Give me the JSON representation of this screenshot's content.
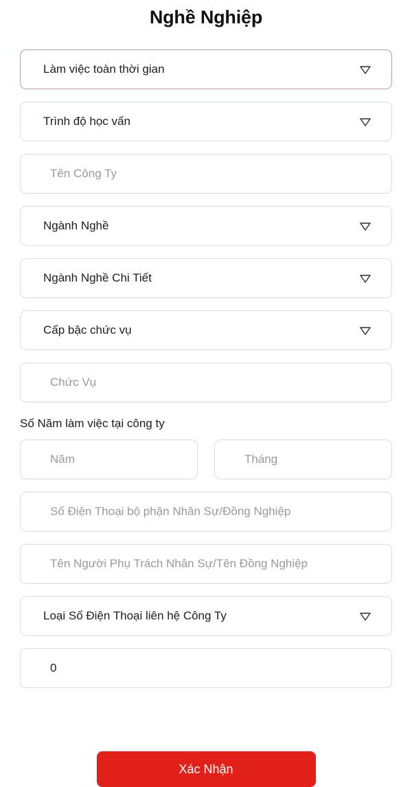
{
  "header": {
    "title": "Nghề Nghiệp"
  },
  "colors": {
    "accent_red": "#e2201a",
    "focused_border": "#c79a9a",
    "default_border": "#dcdcdc",
    "placeholder_text": "#9a9a9a",
    "value_text": "#1d1d1d"
  },
  "icons": {
    "dropdown_caret": "▽"
  },
  "form": {
    "fields": [
      {
        "name": "employment-type",
        "kind": "select",
        "value": "Làm việc toàn thời gian",
        "focused": true,
        "has_caret": true
      },
      {
        "name": "education-level",
        "kind": "select",
        "value": "Trình độ học vấn",
        "focused": false,
        "has_caret": true
      },
      {
        "name": "company-name",
        "kind": "input",
        "placeholder": "Tên Công Ty",
        "value": "",
        "focused": false,
        "has_caret": false
      },
      {
        "name": "industry",
        "kind": "select",
        "value": "Ngành Nghề",
        "focused": false,
        "has_caret": true
      },
      {
        "name": "industry-detail",
        "kind": "select",
        "value": "Ngành Nghề Chi Tiết",
        "focused": false,
        "has_caret": true
      },
      {
        "name": "position-level",
        "kind": "select",
        "value": "Cấp bậc chức vụ",
        "focused": false,
        "has_caret": true
      },
      {
        "name": "job-title",
        "kind": "input",
        "placeholder": "Chức Vụ",
        "value": "",
        "focused": false,
        "has_caret": false
      }
    ],
    "tenure": {
      "label": "Số Năm làm việc tại công ty",
      "years": {
        "name": "tenure-years",
        "kind": "input",
        "placeholder": "Năm",
        "value": ""
      },
      "months": {
        "name": "tenure-months",
        "kind": "input",
        "placeholder": "Tháng",
        "value": ""
      }
    },
    "fields_after": [
      {
        "name": "hr-phone",
        "kind": "input",
        "placeholder": "Số Điện Thoại bộ phận Nhân Sự/Đồng Nghiệp",
        "value": "",
        "has_caret": false
      },
      {
        "name": "hr-contact-name",
        "kind": "input",
        "placeholder": "Tên Người Phụ Trách Nhân Sự/Tên Đồng Nghiệp",
        "value": "",
        "has_caret": false
      },
      {
        "name": "company-phone-type",
        "kind": "select",
        "value": "Loại Số Điện Thoại liên hệ Công Ty",
        "has_caret": true
      },
      {
        "name": "company-phone-number",
        "kind": "input",
        "placeholder": "0",
        "value": "0",
        "has_caret": false
      }
    ]
  },
  "footer": {
    "confirm_label": "Xác Nhận"
  }
}
